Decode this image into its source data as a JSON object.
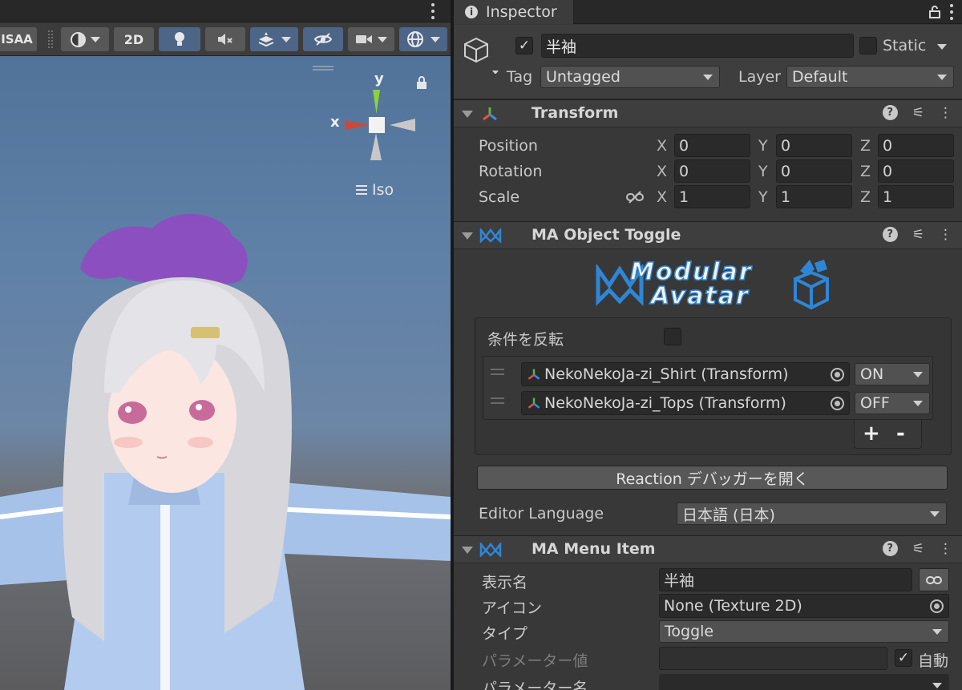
{
  "scene": {
    "toolbar": {
      "msaa_label": "ISAA",
      "mode_2d_label": "2D"
    },
    "gizmo": {
      "x_label": "x",
      "y_label": "y",
      "projection_label": "Iso"
    }
  },
  "inspector": {
    "tab_label": "Inspector",
    "object": {
      "active": true,
      "name": "半袖",
      "static_label": "Static",
      "static_checked": false,
      "tag_label": "Tag",
      "tag_value": "Untagged",
      "layer_label": "Layer",
      "layer_value": "Default"
    },
    "transform": {
      "title": "Transform",
      "rows": [
        {
          "label": "Position",
          "x": "0",
          "y": "0",
          "z": "0"
        },
        {
          "label": "Rotation",
          "x": "0",
          "y": "0",
          "z": "0"
        },
        {
          "label": "Scale",
          "x": "1",
          "y": "1",
          "z": "1"
        }
      ],
      "axis_x": "X",
      "axis_y": "Y",
      "axis_z": "Z"
    },
    "object_toggle": {
      "title": "MA Object Toggle",
      "logo_line1": "Modular",
      "logo_line2": "Avatar",
      "invert_label": "条件を反転",
      "invert_checked": false,
      "entries": [
        {
          "object": "NekoNekoJa-zi_Shirt (Transform)",
          "state": "ON"
        },
        {
          "object": "NekoNekoJa-zi_Tops (Transform)",
          "state": "OFF"
        }
      ],
      "add_label": "+",
      "remove_label": "-",
      "debugger_button": "Reaction デバッガーを開く",
      "language_label": "Editor Language",
      "language_value": "日本語 (日本)"
    },
    "menu_item": {
      "title": "MA Menu Item",
      "display_name_label": "表示名",
      "display_name_value": "半袖",
      "icon_label": "アイコン",
      "icon_value": "None (Texture 2D)",
      "type_label": "タイプ",
      "type_value": "Toggle",
      "param_value_label": "パラメーター値",
      "param_value": "",
      "auto_label": "自動",
      "auto_checked": true,
      "param_name_label": "パラメーター名",
      "param_name_value": ""
    }
  },
  "colors": {
    "accent": "#4d6587",
    "modular_avatar_blue": "#2f86d6",
    "gizmo_x": "#c94a3a",
    "gizmo_y": "#8dd13b",
    "halo": "#9b3fc8"
  }
}
